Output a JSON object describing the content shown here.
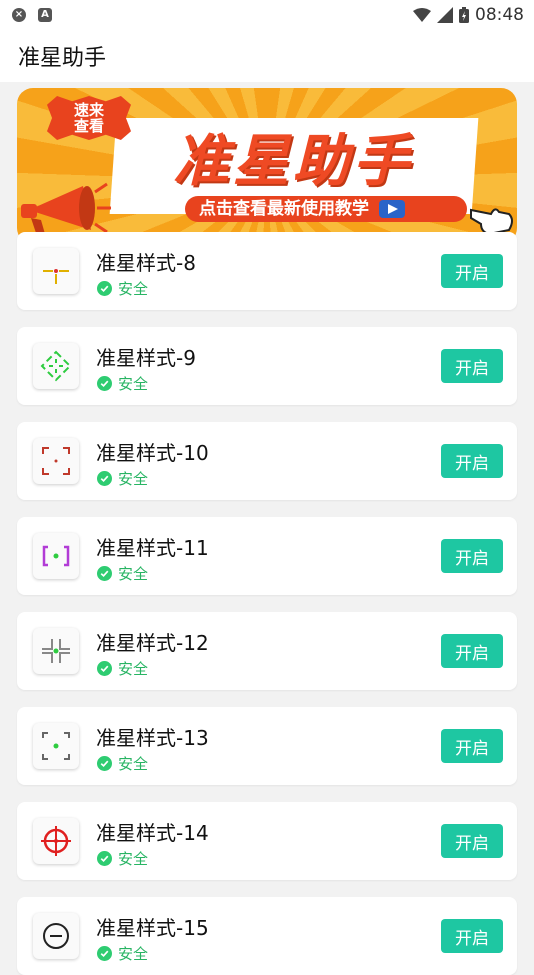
{
  "status_bar": {
    "time": "08:48",
    "left_icons": [
      "shield-x-icon",
      "a-icon"
    ],
    "right_icons": [
      "wifi-icon",
      "signal-icon",
      "battery-icon"
    ]
  },
  "app_bar": {
    "title": "准星助手"
  },
  "banner": {
    "badge_line1": "速来",
    "badge_line2": "查看",
    "title": "准星助手",
    "subtitle": "点击查看最新使用教学"
  },
  "colors": {
    "accent": "#1ec7a2",
    "safe": "#28b463",
    "banner_orange": "#f6a21a",
    "banner_red": "#e8431e"
  },
  "items": [
    {
      "title": "准星样式-8",
      "status": "安全",
      "button": "开启",
      "icon": "crosshair-yellow-icon"
    },
    {
      "title": "准星样式-9",
      "status": "安全",
      "button": "开启",
      "icon": "crosshair-green-circle-icon"
    },
    {
      "title": "准星样式-10",
      "status": "安全",
      "button": "开启",
      "icon": "crosshair-red-corners-icon"
    },
    {
      "title": "准星样式-11",
      "status": "安全",
      "button": "开启",
      "icon": "crosshair-purple-bracket-icon"
    },
    {
      "title": "准星样式-12",
      "status": "安全",
      "button": "开启",
      "icon": "crosshair-gray-cross-icon"
    },
    {
      "title": "准星样式-13",
      "status": "安全",
      "button": "开启",
      "icon": "crosshair-corner-dot-icon"
    },
    {
      "title": "准星样式-14",
      "status": "安全",
      "button": "开启",
      "icon": "crosshair-red-scope-icon"
    },
    {
      "title": "准星样式-15",
      "status": "安全",
      "button": "开启",
      "icon": "crosshair-black-circle-icon"
    }
  ]
}
